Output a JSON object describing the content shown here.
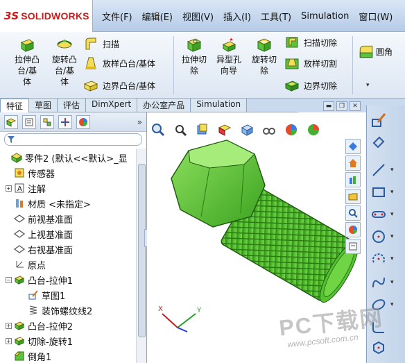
{
  "app": {
    "logo_symbol": "3S",
    "logo_text": "SOLIDWORKS",
    "brand_color": "#d01a1a"
  },
  "menu": {
    "items": [
      "文件(F)",
      "编辑(E)",
      "视图(V)",
      "插入(I)",
      "工具(T)",
      "Simulation",
      "窗口(W)"
    ]
  },
  "ribbon": {
    "extrude_boss": "拉伸凸\n台/基\n体",
    "revolve_boss": "旋转凸\n台/基\n体",
    "sweep": "扫描",
    "loft_boss": "放样凸台/基体",
    "boundary_boss": "边界凸台/基体",
    "extrude_cut": "拉伸切\n除",
    "hole_wizard": "异型孔\n向导",
    "revolve_cut": "旋转切\n除",
    "swept_cut": "扫描切除",
    "lofted_cut": "放样切割",
    "boundary_cut": "边界切除",
    "fillet": "圆角"
  },
  "tabs": [
    "特征",
    "草图",
    "评估",
    "DimXpert",
    "办公室产品",
    "Simulation"
  ],
  "active_tab": "特征",
  "tree": {
    "items": [
      {
        "label": "零件2 (默认<<默认>_显",
        "level": 0,
        "expander": "",
        "icon": "part-icon"
      },
      {
        "label": "传感器",
        "level": 1,
        "expander": "",
        "icon": "sensor-icon"
      },
      {
        "label": "注解",
        "level": 1,
        "expander": "+",
        "icon": "annotation-icon"
      },
      {
        "label": "材质 <未指定>",
        "level": 1,
        "expander": "",
        "icon": "material-icon"
      },
      {
        "label": "前视基准面",
        "level": 1,
        "expander": "",
        "icon": "plane-icon"
      },
      {
        "label": "上视基准面",
        "level": 1,
        "expander": "",
        "icon": "plane-icon"
      },
      {
        "label": "右视基准面",
        "level": 1,
        "expander": "",
        "icon": "plane-icon"
      },
      {
        "label": "原点",
        "level": 1,
        "expander": "",
        "icon": "origin-icon"
      },
      {
        "label": "凸台-拉伸1",
        "level": 1,
        "expander": "−",
        "icon": "extrude-feature-icon"
      },
      {
        "label": "草图1",
        "level": 2,
        "expander": "",
        "icon": "sketch-icon"
      },
      {
        "label": "装饰螺纹线2",
        "level": 2,
        "expander": "",
        "icon": "thread-icon"
      },
      {
        "label": "凸台-拉伸2",
        "level": 1,
        "expander": "+",
        "icon": "extrude-feature-icon"
      },
      {
        "label": "切除-旋转1",
        "level": 1,
        "expander": "+",
        "icon": "revolve-cut-icon"
      },
      {
        "label": "倒角1",
        "level": 1,
        "expander": "",
        "icon": "chamfer-icon"
      }
    ]
  },
  "graphics": {
    "triad_x": "X",
    "triad_y": "Y",
    "model_color": "#4fc42b"
  },
  "watermark": {
    "main": "PC下载网",
    "url": "www.pcsoft.com.cn"
  }
}
